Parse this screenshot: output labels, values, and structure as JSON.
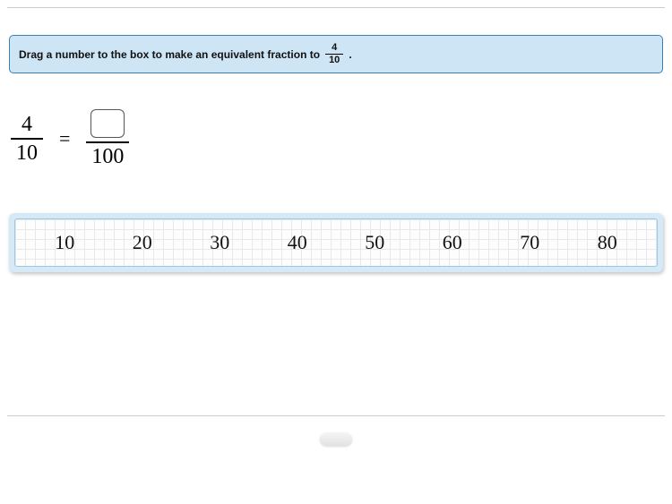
{
  "prompt": {
    "text_before": "Drag a number to the box to make an equivalent fraction to",
    "frac_num": "4",
    "frac_den": "10",
    "text_after": "."
  },
  "equation": {
    "left_num": "4",
    "left_den": "10",
    "equals": "=",
    "right_num_box": "",
    "right_den": "100"
  },
  "tiles": {
    "t0": "10",
    "t1": "20",
    "t2": "30",
    "t3": "40",
    "t4": "50",
    "t5": "60",
    "t6": "70",
    "t7": "80"
  }
}
